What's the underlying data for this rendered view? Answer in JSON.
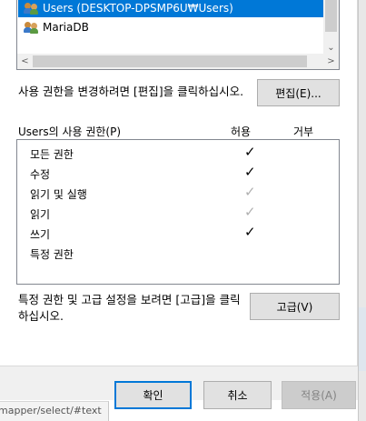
{
  "groups": {
    "items": [
      {
        "label": "Users (DESKTOP-DPSMP6U₩Users)",
        "selected": true
      },
      {
        "label": "MariaDB",
        "selected": false
      }
    ]
  },
  "edit_hint": "사용 권한을 변경하려면 [편집]을 클릭하십시오.",
  "edit_button": "편집(E)...",
  "permissions": {
    "header": "Users의 사용 권한(P)",
    "allow_label": "허용",
    "deny_label": "거부",
    "rows": [
      {
        "name": "모든 권한",
        "allow": "✓",
        "allow_state": "checked"
      },
      {
        "name": "수정",
        "allow": "✓",
        "allow_state": "checked"
      },
      {
        "name": "읽기 및 실행",
        "allow": "✓",
        "allow_state": "inherited"
      },
      {
        "name": "읽기",
        "allow": "✓",
        "allow_state": "inherited"
      },
      {
        "name": "쓰기",
        "allow": "✓",
        "allow_state": "checked"
      },
      {
        "name": "특정 권한",
        "allow": "",
        "allow_state": "none"
      }
    ]
  },
  "advanced_hint": "특정 권한 및 고급 설정을 보려면 [고급]을 클릭하십시오.",
  "advanced_button": "고급(V)",
  "footer": {
    "ok": "확인",
    "cancel": "취소",
    "apply": "적용(A)"
  },
  "background_text": "mapper/select/#text",
  "colors": {
    "selection": "#0078d7",
    "check_on": "#000000",
    "check_dim": "#b0b0b0"
  }
}
